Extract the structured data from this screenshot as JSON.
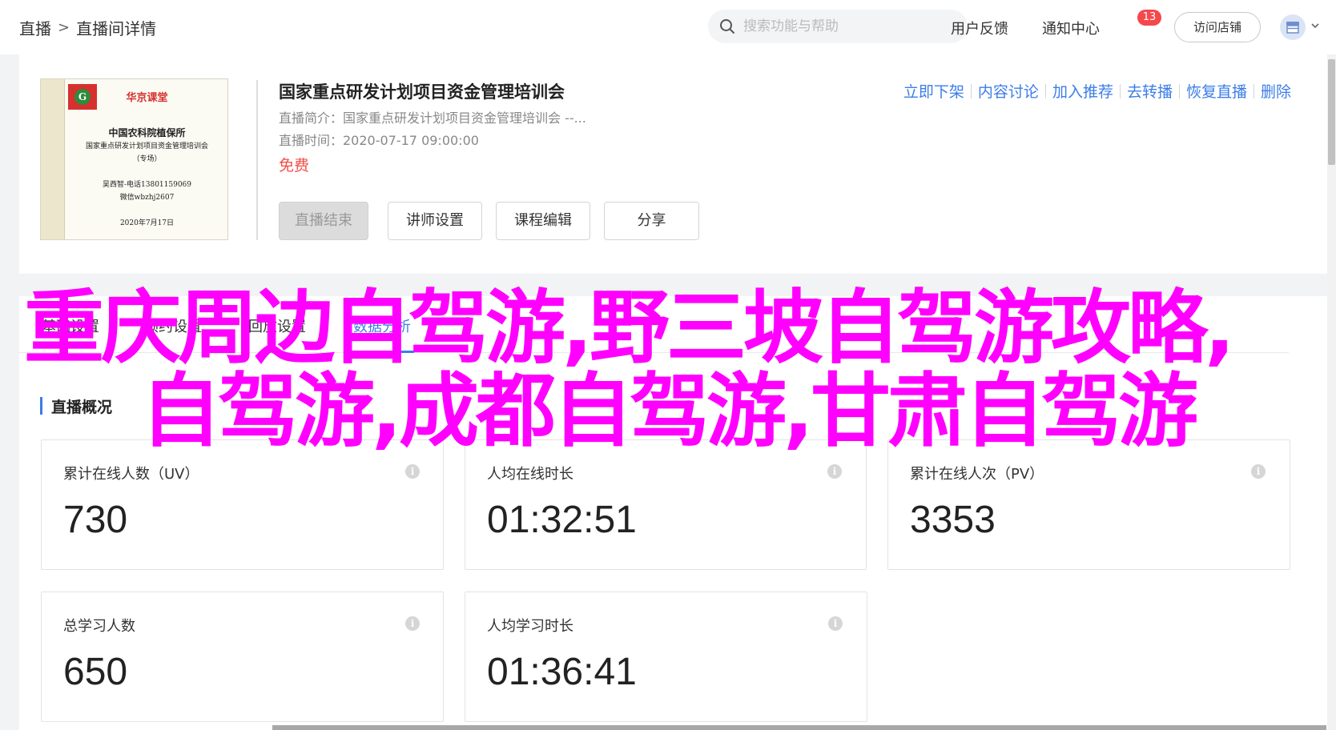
{
  "header": {
    "breadcrumb_root": "直播",
    "breadcrumb_sep": ">",
    "breadcrumb_current": "直播间详情",
    "search_placeholder": "搜索功能与帮助",
    "feedback": "用户反馈",
    "notifications": "通知中心",
    "notification_count": "13",
    "visit_store": "访问店铺"
  },
  "course": {
    "title": "国家重点研发计划项目资金管理培训会",
    "intro": "直播简介：国家重点研发计划项目资金管理培训会 --...",
    "time": "直播时间：2020-07-17 09:00:00",
    "price": "免费",
    "cover": {
      "brand": "华京课堂",
      "org": "中国农科院植保所",
      "subject": "国家重点研发计划项目资金管理培训会",
      "tag": "（专场）",
      "contact_phone": "吴西智-电话13801159069",
      "contact_wechat": "微信wbzhj2607",
      "date": "2020年7月17日"
    },
    "actions": [
      "立即下架",
      "内容讨论",
      "加入推荐",
      "去转播",
      "恢复直播",
      "删除"
    ],
    "buttons": {
      "end_live": "直播结束",
      "lecturer": "讲师设置",
      "edit": "课程编辑",
      "share": "分享"
    }
  },
  "tabs": [
    "基础设置",
    "预约设置",
    "回放设置",
    "数据分析"
  ],
  "overview": {
    "title": "直播概况",
    "stats": [
      {
        "label": "累计在线人数（UV）",
        "value": "730"
      },
      {
        "label": "人均在线时长",
        "value": "01:32:51"
      },
      {
        "label": "累计在线人次（PV）",
        "value": "3353"
      },
      {
        "label": "总学习人数",
        "value": "650"
      },
      {
        "label": "人均学习时长",
        "value": "01:36:41"
      }
    ]
  },
  "overlay": {
    "line1": "重庆周边自驾游,野三坡自驾游攻略,",
    "line2": "自驾游,成都自驾游,甘肃自驾游"
  },
  "colors": {
    "accent": "#3b7de8",
    "price": "#f04e46",
    "badge": "#f5484d",
    "overlay": "#ff00ff"
  }
}
